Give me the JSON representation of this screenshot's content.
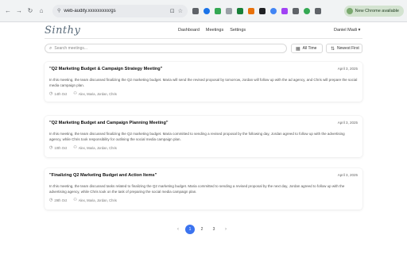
{
  "browser": {
    "url": "web-audity.xxxxxxxxx/gs",
    "profile_label": "New Chrome available"
  },
  "app": {
    "logo": "Sinthy",
    "nav": [
      "Dashboard",
      "Meetings",
      "Settings"
    ],
    "user": "Daniel Madi"
  },
  "toolbar": {
    "search_placeholder": "Search meetings...",
    "filter_label": "All Time",
    "sort_label": "Newest First"
  },
  "meetings": [
    {
      "title": "\"Q2 Marketing Budget & Campaign Strategy Meeting\"",
      "date": "April 3, 2025",
      "summary": "In this meeting, the team discussed finalizing the Q2 marketing budget. Maria will send the revised proposal by tomorrow, Jordan will follow up with the ad agency, and Chris will prepare the social media campaign plan.",
      "duration": "14th Oct",
      "participants": "Alex, Maria, Jordan, Chris"
    },
    {
      "title": "\"Q2 Marketing Budget and Campaign Planning Meeting\"",
      "date": "April 3, 2025",
      "summary": "In this meeting, the team discussed finalizing the Q2 marketing budget. Maria committed to sending a revised proposal by the following day, Jordan agreed to follow up with the advertising agency, while Chris took responsibility for outlining the social media campaign plan.",
      "duration": "10th Oct",
      "participants": "Alex, Maria, Jordan, Chris"
    },
    {
      "title": "\"Finalizing Q2 Marketing Budget and Action Items\"",
      "date": "April 3, 2025",
      "summary": "In this meeting, the team discussed tasks related to finalizing the Q2 marketing budget. Maria committed to sending a revised proposal by the next day, Jordan agreed to follow up with the advertising agency, while Chris took on the task of preparing the social media campaign plan.",
      "duration": "29th Oct",
      "participants": "Alex, Maria, Jordan, Chris"
    }
  ],
  "pagination": {
    "prev": "‹",
    "pages": [
      "1",
      "2",
      "3"
    ],
    "next": "›",
    "current": "1"
  }
}
